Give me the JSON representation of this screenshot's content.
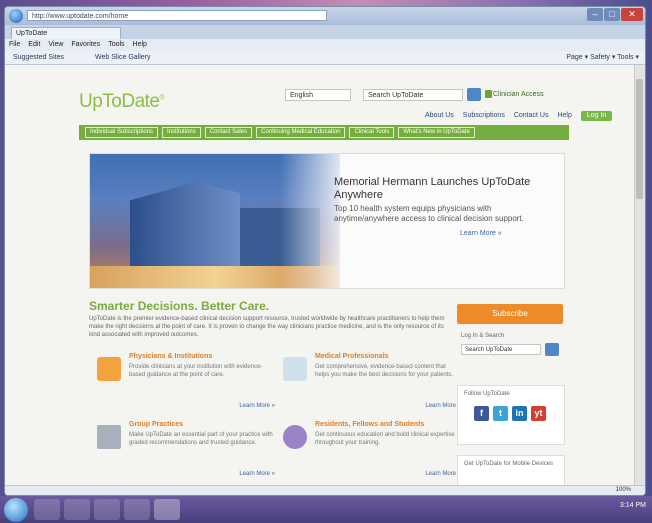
{
  "browser": {
    "address": "http://www.uptodate.com/home",
    "tab_label": "UpToDate",
    "menu": [
      "File",
      "Edit",
      "View",
      "Favorites",
      "Tools",
      "Help"
    ],
    "favorites": [
      "Suggested Sites",
      "Web Slice Gallery"
    ],
    "toolbar_right": "Page ▾  Safety ▾  Tools ▾",
    "zoom": "100%"
  },
  "site": {
    "logo": "UpToDate",
    "language": "English",
    "search_placeholder": "Search UpToDate",
    "clinician_link": "Clinician Access",
    "util_nav": [
      "About Us",
      "Subscriptions",
      "Contact Us",
      "Help"
    ],
    "login_label": "Log In",
    "main_nav": [
      "Individual Subscriptions",
      "Institutions",
      "Contact Sales",
      "Continuing Medical Education",
      "Clinical Tools",
      "What's New in UpToDate"
    ]
  },
  "hero": {
    "headline": "Memorial Hermann Launches UpToDate Anywhere",
    "text": "Top 10 health system equips physicians with anytime/anywhere access to clinical decision support.",
    "more": "Learn More »"
  },
  "section": {
    "title": "Smarter Decisions. Better Care.",
    "text": "UpToDate is the premier evidence-based clinical decision support resource, trusted worldwide by healthcare practitioners to help them make the right decisions at the point of care. It is proven to change the way clinicians practice medicine, and is the only resource of its kind associated with improved outcomes."
  },
  "cards": [
    {
      "title": "Physicians & Institutions",
      "text": "Provide clinicians at your institution with evidence-based guidance at the point of care.",
      "more": "Learn More »"
    },
    {
      "title": "Medical Professionals",
      "text": "Get comprehensive, evidence-based content that helps you make the best decisions for your patients.",
      "more": "Learn More »"
    },
    {
      "title": "Group Practices",
      "text": "Make UpToDate an essential part of your practice with graded recommendations and trusted guidance.",
      "more": "Learn More »"
    },
    {
      "title": "Residents, Fellows and Students",
      "text": "Get continuous education and build clinical expertise throughout your training.",
      "more": "Learn More »"
    }
  ],
  "sidebar": {
    "subscribe": "Subscribe",
    "log_in_label": "Log In & Search",
    "search_select": "Search UpToDate",
    "follow_label": "Follow UpToDate",
    "social": [
      "f",
      "t",
      "in",
      "yt"
    ],
    "widget_label": "Get UpToDate for Mobile Devices"
  },
  "taskbar": {
    "clock": "3:14 PM"
  }
}
